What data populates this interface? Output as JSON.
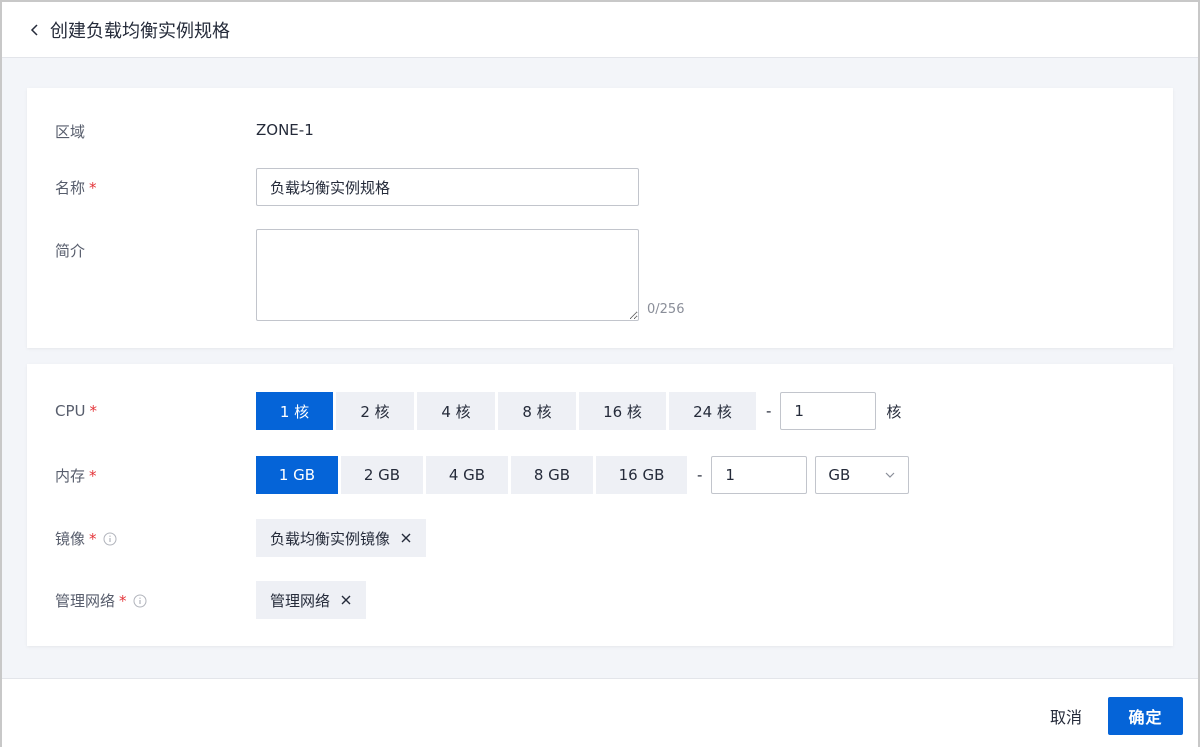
{
  "header": {
    "title": "创建负载均衡实例规格"
  },
  "form": {
    "zone": {
      "label": "区域",
      "value": "ZONE-1"
    },
    "name": {
      "label": "名称",
      "required_mark": "*",
      "value": "负载均衡实例规格"
    },
    "description": {
      "label": "简介",
      "value": "",
      "counter": "0/256"
    },
    "cpu": {
      "label": "CPU",
      "required_mark": "*",
      "options": [
        "1 核",
        "2 核",
        "4 核",
        "8 核",
        "16 核",
        "24 核"
      ],
      "selected": "1 核",
      "dash": "-",
      "custom_value": "1",
      "unit": "核"
    },
    "memory": {
      "label": "内存",
      "required_mark": "*",
      "options": [
        "1 GB",
        "2 GB",
        "4 GB",
        "8 GB",
        "16 GB"
      ],
      "selected": "1 GB",
      "dash": "-",
      "custom_value": "1",
      "unit_selected": "GB"
    },
    "image": {
      "label": "镜像",
      "required_mark": "*",
      "tag": "负载均衡实例镜像"
    },
    "network": {
      "label": "管理网络",
      "required_mark": "*",
      "tag": "管理网络"
    }
  },
  "footer": {
    "cancel_label": "取消",
    "ok_label": "确定"
  },
  "colors": {
    "primary": "#0564d8",
    "required": "#e4353a",
    "tag_bg": "#eef0f5"
  },
  "icons": {
    "back": "chevron-left-icon",
    "info": "info-icon",
    "close": "close-icon",
    "dropdown": "chevron-down-icon"
  }
}
